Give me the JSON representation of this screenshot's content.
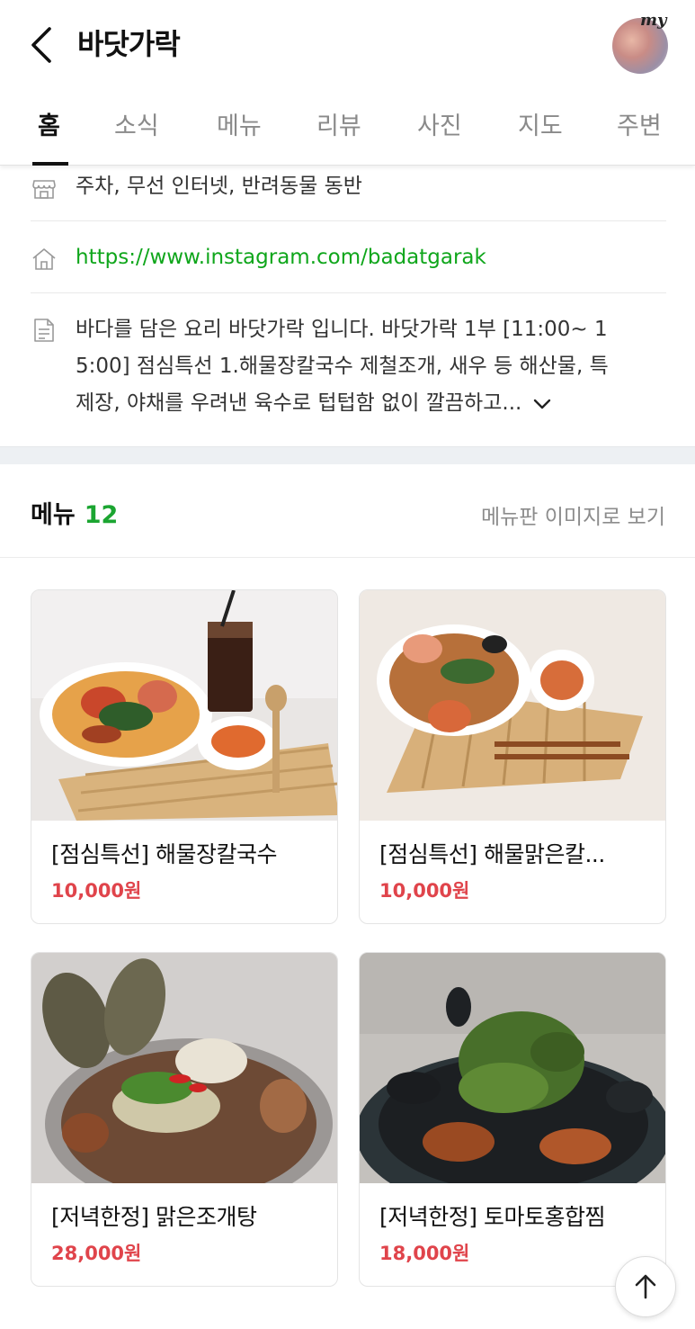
{
  "header": {
    "title": "바닷가락",
    "avatar_badge": "my"
  },
  "tabs": [
    {
      "label": "홈",
      "active": true
    },
    {
      "label": "소식"
    },
    {
      "label": "메뉴"
    },
    {
      "label": "리뷰"
    },
    {
      "label": "사진"
    },
    {
      "label": "지도"
    },
    {
      "label": "주변"
    }
  ],
  "info": {
    "amenities": "주차, 무선 인터넷, 반려동물 동반",
    "homepage": "https://www.instagram.com/badatgarak",
    "description_lines": [
      "바다를 담은 요리 바닷가락 입니다. 바닷가락 1부 [11:00~ 1",
      "5:00] 점심특선 1.해물장칼국수 제철조개, 새우 등 해산물, 특",
      "제장, 야채를 우려낸 육수로 텁텁함 없이 깔끔하고..."
    ]
  },
  "menu": {
    "heading": "메뉴",
    "count": "12",
    "image_view_link": "메뉴판 이미지로 보기",
    "items": [
      {
        "name": "[점심특선] 해물장칼국수",
        "price": "10,000원"
      },
      {
        "name": "[점심특선] 해물맑은칼...",
        "price": "10,000원"
      },
      {
        "name": "[저녁한정] 맑은조개탕",
        "price": "28,000원"
      },
      {
        "name": "[저녁한정] 토마토홍합찜",
        "price": "18,000원"
      }
    ]
  },
  "colors": {
    "link_green": "#0fa61b",
    "count_green": "#1ba531",
    "price_red": "#e0444b"
  },
  "icons": [
    "back-arrow-icon",
    "store-icon",
    "home-icon",
    "document-icon",
    "chevron-down-icon",
    "arrow-up-icon"
  ]
}
